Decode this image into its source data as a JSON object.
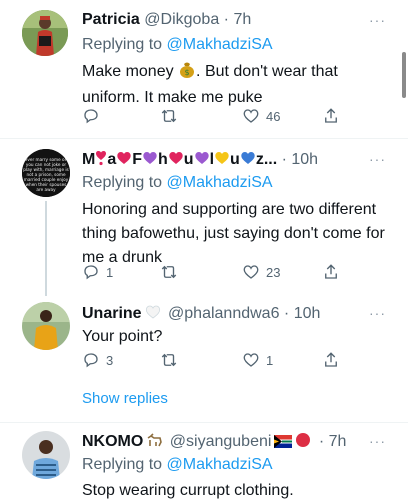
{
  "tweets": [
    {
      "name": "Patricia",
      "handle": "@Dikgoba",
      "time": "· 7h",
      "reply_prefix": "Replying to ",
      "reply_to": "@MakhadziSA",
      "text_a": "Make money ",
      "text_b": ". But don't wear that uniform.  It make me puke",
      "emoji_icon": "money-bag-icon",
      "likes": "46",
      "more": "···"
    },
    {
      "name_tail": "z...",
      "time": "· 10h",
      "reply_prefix": "Replying to ",
      "reply_to": "@MakhadziSA",
      "text": "Honoring and supporting are two different thing bafowethu, just saying don't come for me a drunk",
      "avatar_text": "never marry some one you can not joke or play with, marriage is not a prison, some married couple enjoy when their spouses are away",
      "replies": "1",
      "likes": "23",
      "more": "···"
    },
    {
      "name": "Unarine",
      "handle": "@phalanndwa6",
      "time": "· 10h",
      "text": "Your point?",
      "replies": "3",
      "likes": "1",
      "more": "···"
    },
    {
      "name": "NKOMO",
      "handle": "@siyangubeni",
      "time": "· 7h",
      "reply_prefix": "Replying to ",
      "reply_to": "@MakhadziSA",
      "text": "Stop wearing currupt clothing.",
      "more": "···"
    }
  ],
  "show_replies": "Show replies",
  "colors": {
    "link": "#1d9bf0",
    "secondary": "#536471",
    "divider": "#eff3f4"
  }
}
